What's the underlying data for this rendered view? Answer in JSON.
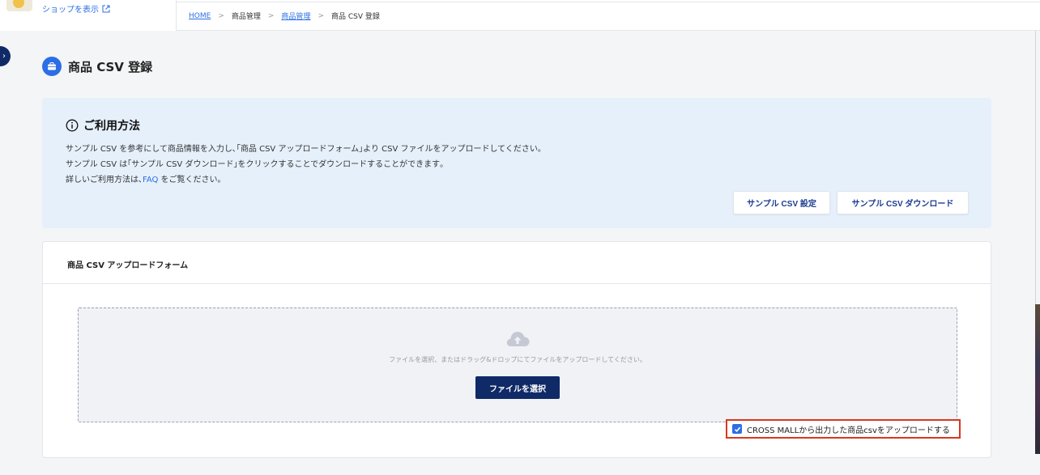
{
  "topbar": {
    "shop_link_label": "ショップを表示",
    "breadcrumb": {
      "home": "HOME",
      "sep": ">",
      "product_admin": "商品管理",
      "product_admin_link": "商品管理",
      "current": "商品 CSV 登録"
    }
  },
  "page": {
    "title": "商品 CSV 登録"
  },
  "info": {
    "heading": "ご利用方法",
    "line1": "サンプル CSV を参考にして商品情報を入力し､｢商品 CSV アップロードフォーム｣より CSV ファイルをアップロードしてください｡",
    "line2": "サンプル CSV は｢サンプル CSV ダウンロード｣をクリックすることでダウンロードすることができます｡",
    "line3_pre": "詳しいご利用方法は､",
    "line3_link": "FAQ",
    "line3_post": " をご覧ください｡",
    "btn_settings": "サンプル CSV 設定",
    "btn_download": "サンプル CSV ダウンロード"
  },
  "upload": {
    "card_title": "商品 CSV アップロードフォーム",
    "drop_text": "ファイルを選択、またはドラッグ&ドロップにてファイルをアップロードしてください。",
    "select_button": "ファイルを選択",
    "crossmall_label": "CROSS MALLから出力した商品csvをアップロードする",
    "crossmall_checked": true
  },
  "colors": {
    "accent": "#2c6ee6",
    "navy": "#0f2a66",
    "info_bg": "#e6f0fb",
    "highlight_border": "#d8381f"
  }
}
